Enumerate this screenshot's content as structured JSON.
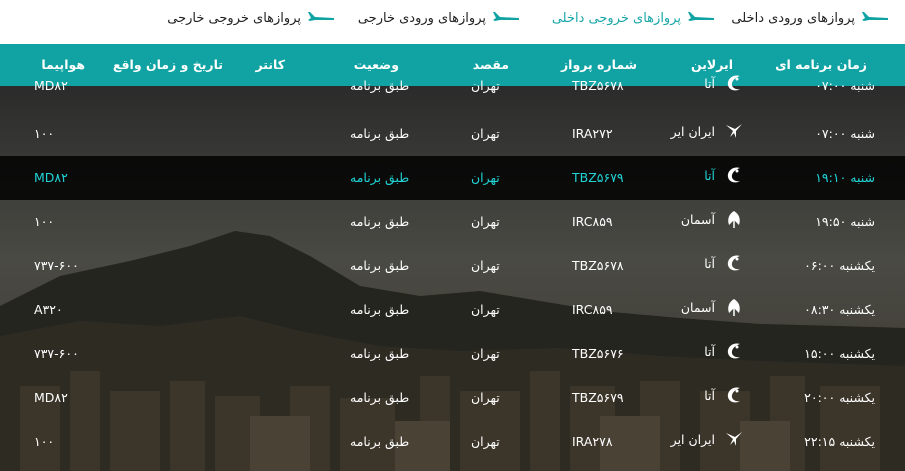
{
  "tabs": [
    {
      "label": "پروازهای ورودی داخلی",
      "active": false
    },
    {
      "label": "پروازهای خروجی داخلی",
      "active": true
    },
    {
      "label": "پروازهای ورودی خارجی",
      "active": false
    },
    {
      "label": "پروازهای خروجی خارجی",
      "active": false
    }
  ],
  "columns": {
    "time": "زمان برنامه ای",
    "airline": "ایرلاین",
    "flight": "شماره پرواز",
    "destination": "مقصد",
    "status": "وضعیت",
    "counter": "کانتر",
    "actual": "تاریخ و زمان واقع",
    "aircraft": "هواپیما"
  },
  "rows": [
    {
      "time": "شنبه ۰۷:۰۰",
      "airline": "آتا",
      "logo": "ata-logo-icon",
      "flight": "TBZ۵۶۷۸",
      "destination": "تهران",
      "status": "طبق برنامه",
      "aircraft": "MD۸۲",
      "highlight": false
    },
    {
      "time": "شنبه ۰۷:۰۰",
      "airline": "ایران ایر",
      "logo": "iranair-logo-icon",
      "flight": "IRA۲۷۲",
      "destination": "تهران",
      "status": "طبق برنامه",
      "aircraft": "۱۰۰",
      "highlight": false
    },
    {
      "time": "شنبه ۱۹:۱۰",
      "airline": "آتا",
      "logo": "ata-logo-icon",
      "flight": "TBZ۵۶۷۹",
      "destination": "تهران",
      "status": "طبق برنامه",
      "aircraft": "MD۸۲",
      "highlight": true
    },
    {
      "time": "شنبه ۱۹:۵۰",
      "airline": "آسمان",
      "logo": "aseman-logo-icon",
      "flight": "IRC۸۵۹",
      "destination": "تهران",
      "status": "طبق برنامه",
      "aircraft": "۱۰۰",
      "highlight": false
    },
    {
      "time": "یکشنبه ۰۶:۰۰",
      "airline": "آتا",
      "logo": "ata-logo-icon",
      "flight": "TBZ۵۶۷۸",
      "destination": "تهران",
      "status": "طبق برنامه",
      "aircraft": "۷۳۷-۶۰۰",
      "highlight": false
    },
    {
      "time": "یکشنبه ۰۸:۳۰",
      "airline": "آسمان",
      "logo": "aseman-logo-icon",
      "flight": "IRC۸۵۹",
      "destination": "تهران",
      "status": "طبق برنامه",
      "aircraft": "A۳۲۰",
      "highlight": false
    },
    {
      "time": "یکشنبه ۱۵:۰۰",
      "airline": "آتا",
      "logo": "ata-logo-icon",
      "flight": "TBZ۵۶۷۶",
      "destination": "تهران",
      "status": "طبق برنامه",
      "aircraft": "۷۳۷-۶۰۰",
      "highlight": false
    },
    {
      "time": "یکشنبه ۲۰:۰۰",
      "airline": "آتا",
      "logo": "ata-logo-icon",
      "flight": "TBZ۵۶۷۹",
      "destination": "تهران",
      "status": "طبق برنامه",
      "aircraft": "MD۸۲",
      "highlight": false
    },
    {
      "time": "یکشنبه ۲۲:۱۵",
      "airline": "ایران ایر",
      "logo": "iranair-logo-icon",
      "flight": "IRA۲۷۸",
      "destination": "تهران",
      "status": "طبق برنامه",
      "aircraft": "۱۰۰",
      "highlight": false
    }
  ],
  "colors": {
    "accent": "#11a3a3",
    "highlight_text": "#21d4d6"
  }
}
